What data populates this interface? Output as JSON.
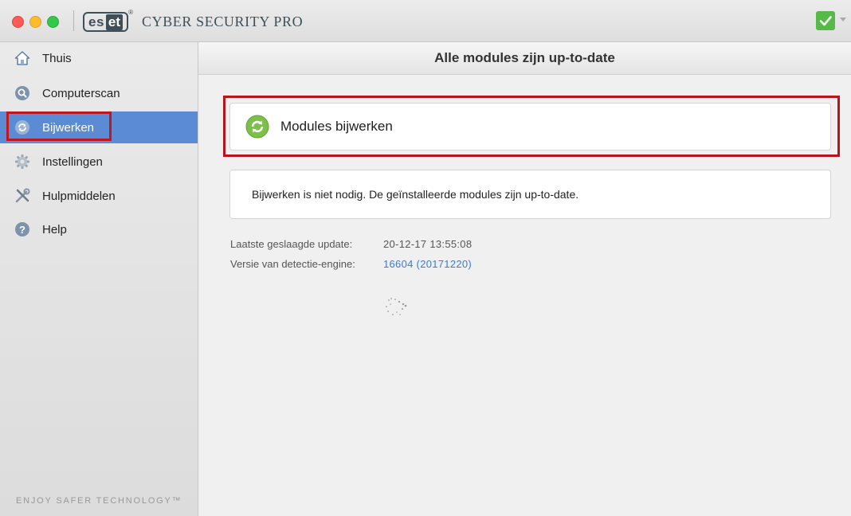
{
  "app": {
    "logo_es": "es",
    "logo_et": "et",
    "logo_reg": "®",
    "title": "CYBER SECURITY PRO",
    "status_icon": "green-check-icon"
  },
  "sidebar": {
    "items": [
      {
        "label": "Thuis",
        "icon": "home-icon",
        "active": false
      },
      {
        "label": "Computerscan",
        "icon": "magnifier-icon",
        "active": false
      },
      {
        "label": "Bijwerken",
        "icon": "update-icon",
        "active": true
      },
      {
        "label": "Instellingen",
        "icon": "gear-icon",
        "active": false
      },
      {
        "label": "Hulpmiddelen",
        "icon": "tools-icon",
        "active": false
      },
      {
        "label": "Help",
        "icon": "help-icon",
        "active": false
      }
    ],
    "tagline": "ENJOY SAFER TECHNOLOGY™"
  },
  "main": {
    "title": "Alle modules zijn up-to-date",
    "update_button": "Modules bijwerken",
    "message": "Bijwerken is niet nodig. De geïnstalleerde modules zijn up-to-date.",
    "info": {
      "last_update_label": "Laatste geslaagde update:",
      "last_update_value": "20-12-17 13:55:08",
      "engine_label": "Versie van detectie-engine:",
      "engine_value": "16604 (20171220)"
    }
  },
  "colors": {
    "accent": "#5b8bd4",
    "highlight_frame": "#c0161c",
    "status_green": "#57b947",
    "link": "#3a7bd5"
  }
}
